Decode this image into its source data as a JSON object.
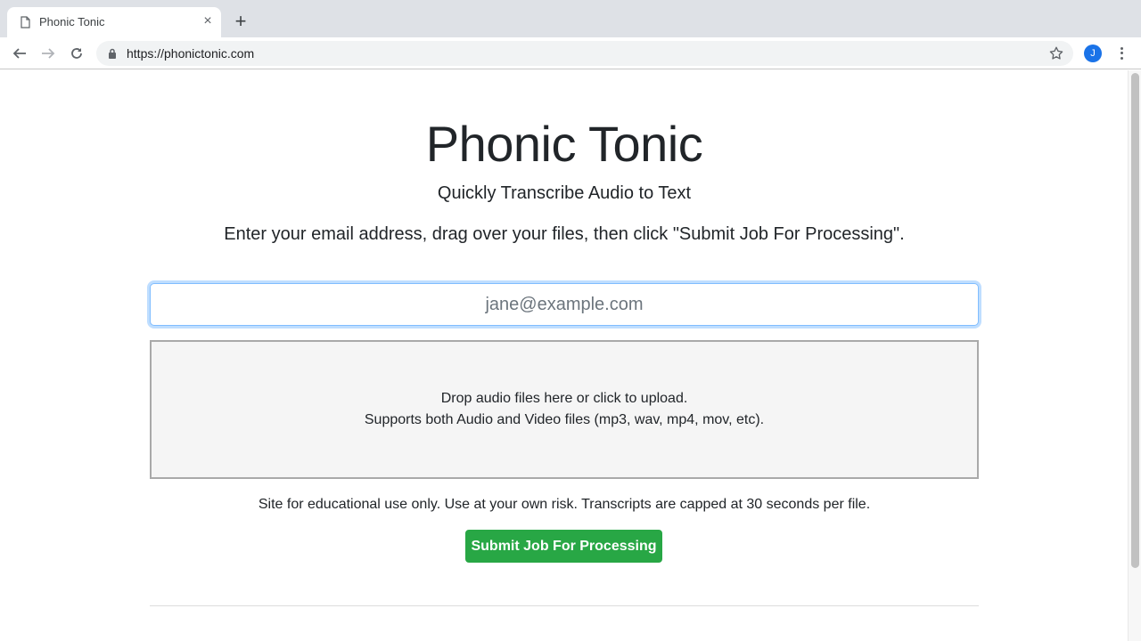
{
  "browser": {
    "tab": {
      "title": "Phonic Tonic",
      "close_glyph": "×"
    },
    "new_tab_glyph": "+",
    "url": "https://phonictonic.com",
    "profile_initial": "J",
    "colors": {
      "profile": "#1a73e8"
    }
  },
  "page": {
    "title": "Phonic Tonic",
    "subtitle": "Quickly Transcribe Audio to Text",
    "instructions": "Enter your email address, drag over your files, then click \"Submit Job For Processing\".",
    "email_input": {
      "value": "",
      "placeholder": "jane@example.com"
    },
    "dropzone": {
      "line1": "Drop audio files here or click to upload.",
      "line2": "Supports both Audio and Video files (mp3, wav, mp4, mov, etc)."
    },
    "disclaimer": "Site for educational use only. Use at your own risk. Transcripts are capped at 30 seconds per file.",
    "submit_label": "Submit Job For Processing",
    "colors": {
      "submit": "#28a745",
      "focus_ring": "#80bdff"
    }
  }
}
